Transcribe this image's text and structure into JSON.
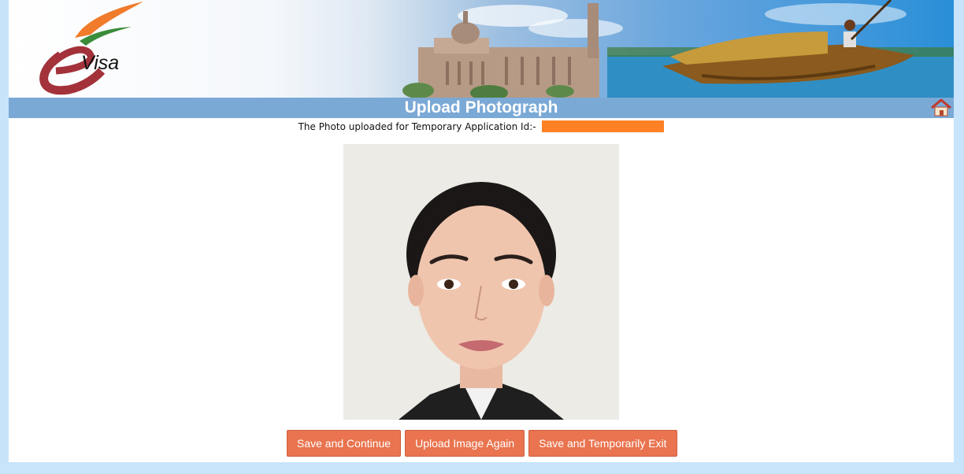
{
  "header": {
    "logo_text": "Visa",
    "home_icon": "home-icon"
  },
  "titlebar": {
    "title": "Upload Photograph"
  },
  "application": {
    "prefix": "The Photo uploaded for Temporary Application Id:-",
    "id_value": ""
  },
  "photo": {
    "content": "uploaded-passport-photo"
  },
  "actions": {
    "save_continue": "Save and Continue",
    "upload_again": "Upload Image Again",
    "save_exit": "Save and Temporarily Exit"
  },
  "colors": {
    "page_bg": "#c7e4fb",
    "titlebar_bg": "#7ba9d6",
    "button_bg": "#e9744f",
    "redaction": "#ff8125"
  }
}
